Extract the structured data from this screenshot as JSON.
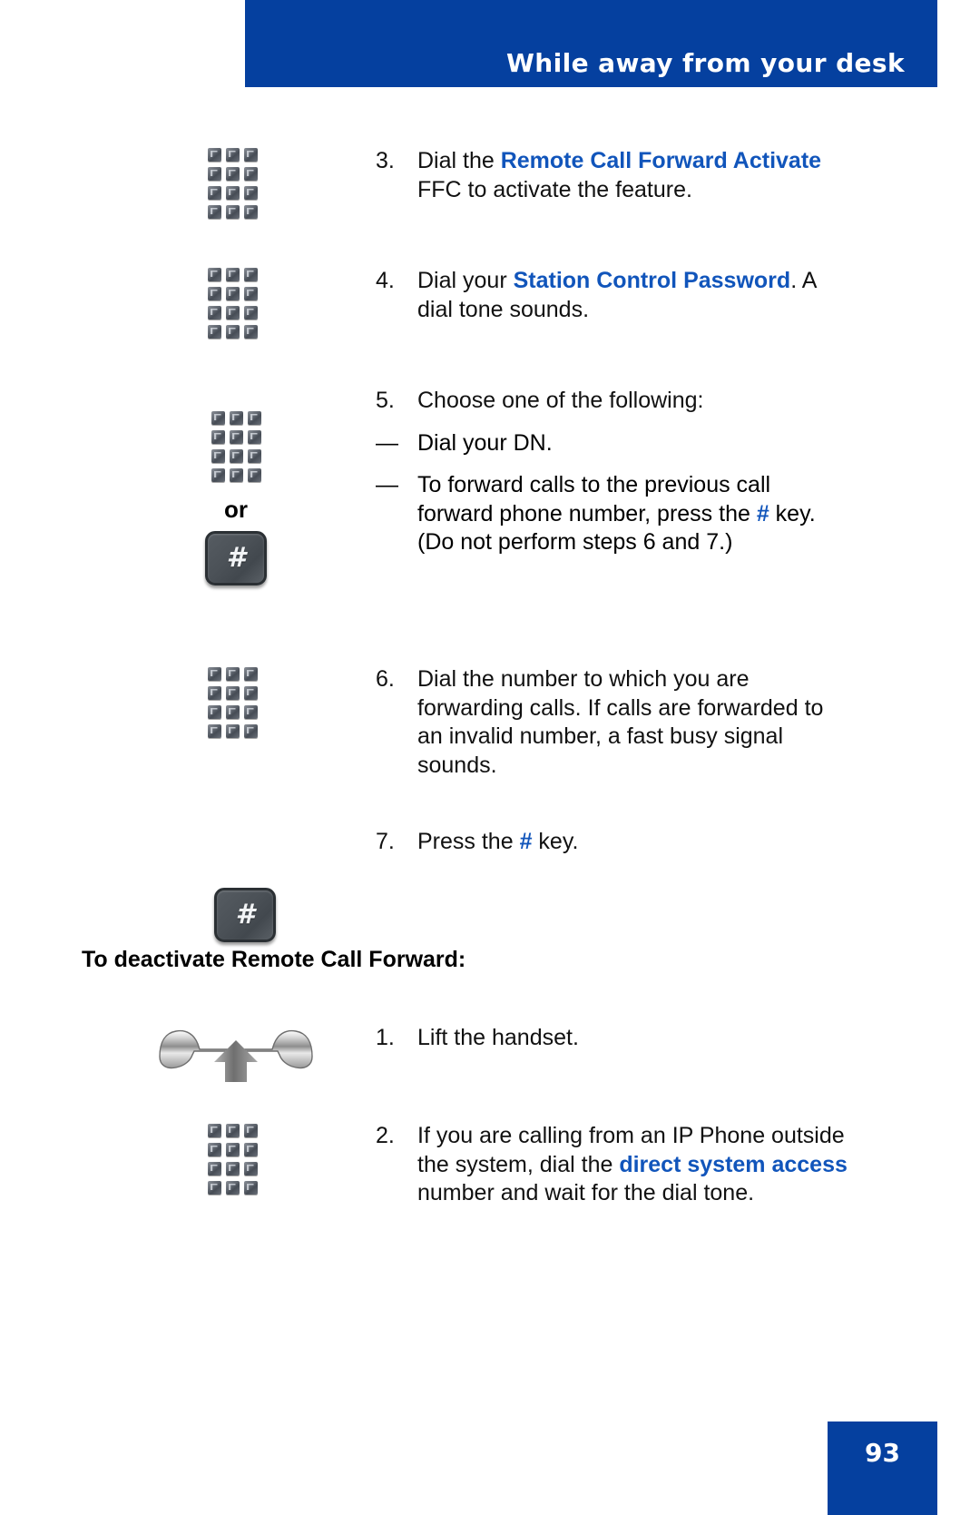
{
  "header": {
    "title": "While away from your desk",
    "banner_color": "#05409f"
  },
  "colors": {
    "accent_blue": "#1155bb",
    "banner_blue": "#05409f",
    "key_dark": "#4b5157"
  },
  "steps": [
    {
      "number": "3.",
      "icon": "keypad-icon",
      "text_parts": [
        {
          "t": "Dial the ",
          "style": "normal"
        },
        {
          "t": "Remote Call Forward Activate",
          "style": "bold-blue"
        },
        {
          "t": " FFC to activate the feature.",
          "style": "normal"
        }
      ]
    },
    {
      "number": "4.",
      "icon": "keypad-icon",
      "text_parts": [
        {
          "t": "Dial your ",
          "style": "normal"
        },
        {
          "t": "Station Control Password",
          "style": "bold-blue"
        },
        {
          "t": ". A dial tone sounds.",
          "style": "normal"
        }
      ]
    },
    {
      "number": "5.",
      "icon": "keypad-or-hash-icon",
      "or_label": "or",
      "text_parts": [
        {
          "t": "Choose one of the following:",
          "style": "normal"
        }
      ],
      "sub_items": [
        {
          "dash": "—",
          "parts": [
            {
              "t": "Dial your DN.",
              "style": "normal"
            }
          ]
        },
        {
          "dash": "—",
          "parts": [
            {
              "t": "To forward calls to the previous call forward phone number, press the ",
              "style": "normal"
            },
            {
              "t": "#",
              "style": "bold-blue"
            },
            {
              "t": " key. (Do not perform steps 6 and 7.)",
              "style": "normal"
            }
          ]
        }
      ]
    },
    {
      "number": "6.",
      "icon": "keypad-icon",
      "text_parts": [
        {
          "t": "Dial the number to which you are forwarding calls. If calls are forwarded to an invalid number, a fast busy signal sounds.",
          "style": "normal"
        }
      ]
    },
    {
      "number": "7.",
      "icon": "hash-key-icon",
      "text_parts": [
        {
          "t": "Press the ",
          "style": "normal"
        },
        {
          "t": "#",
          "style": "bold-blue"
        },
        {
          "t": " key.",
          "style": "normal"
        }
      ]
    }
  ],
  "section": {
    "heading": "To deactivate Remote Call Forward:"
  },
  "deactivate_steps": [
    {
      "number": "1.",
      "icon": "handset-lift-icon",
      "text_parts": [
        {
          "t": "Lift the handset.",
          "style": "normal"
        }
      ]
    },
    {
      "number": "2.",
      "icon": "keypad-icon",
      "text_parts": [
        {
          "t": "If you are calling from an IP Phone outside the system, dial the ",
          "style": "normal"
        },
        {
          "t": "direct system access",
          "style": "bold-blue"
        },
        {
          "t": " number and wait for the dial tone.",
          "style": "normal"
        }
      ]
    }
  ],
  "footer": {
    "page_number": "93"
  }
}
